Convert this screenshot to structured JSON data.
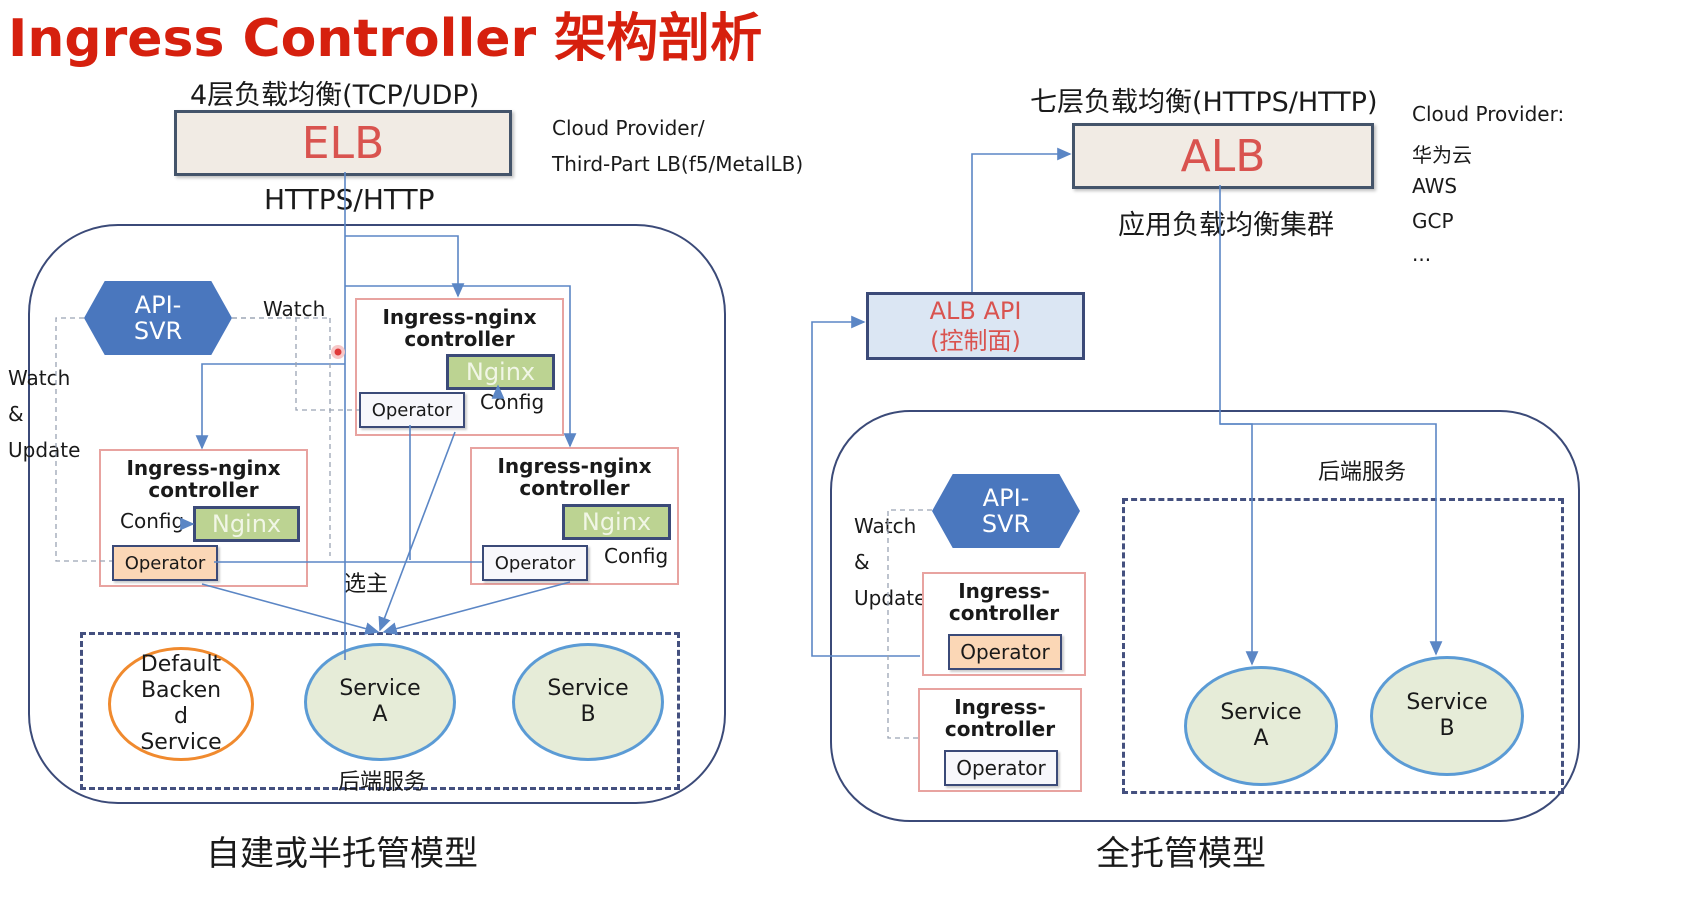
{
  "title": "Ingress Controller 架构剖析",
  "left": {
    "l4_label": "4层负载均衡(TCP/UDP)",
    "elb": "ELB",
    "cloud_line1": "Cloud Provider/",
    "cloud_line2": "Third-Part LB(f5/MetalLB)",
    "protocol": "HTTPS/HTTP",
    "apisvr_line1": "API-",
    "apisvr_line2": "SVR",
    "watch": "Watch",
    "side_watch": "Watch",
    "side_amp": "&",
    "side_update": "Update",
    "ctrl_top_title": "Ingress-nginx\ncontroller",
    "ctrl_top_nginx": "Nginx",
    "ctrl_top_operator": "Operator",
    "ctrl_top_config": "Config",
    "ctrl_left_title": "Ingress-nginx\ncontroller",
    "ctrl_left_nginx": "Nginx",
    "ctrl_left_config": "Config",
    "ctrl_left_operator": "Operator",
    "ctrl_right_title": "Ingress-nginx\ncontroller",
    "ctrl_right_nginx": "Nginx",
    "ctrl_right_operator": "Operator",
    "ctrl_right_config": "Config",
    "leader": "选主",
    "svc_default": "Default\nBacken\nd\nService",
    "svc_a": "Service\nA",
    "svc_b": "Service\nB",
    "backend": "后端服务",
    "caption": "自建或半托管模型"
  },
  "right": {
    "l7_label": "七层负载均衡(HTTPS/HTTP)",
    "alb": "ALB",
    "alb_cluster": "应用负载均衡集群",
    "cloud_label": "Cloud Provider:",
    "cloud_items": [
      "华为云",
      "AWS",
      "GCP",
      "..."
    ],
    "alb_api_line1": "ALB API",
    "alb_api_line2": "(控制面)",
    "backend": "后端服务",
    "apisvr_line1": "API-",
    "apisvr_line2": "SVR",
    "side_watch": "Watch",
    "side_amp": "&",
    "side_update": "Update",
    "ctrl1_title": "Ingress-\ncontroller",
    "ctrl1_operator": "Operator",
    "ctrl2_title": "Ingress-\ncontroller",
    "ctrl2_operator": "Operator",
    "svc_a": "Service\nA",
    "svc_b": "Service\nB",
    "caption": "全托管模型"
  },
  "colors": {
    "title": "#d6200e",
    "lb_text": "#d9534f",
    "hex": "#4a77be",
    "nginx": "#bcd392",
    "arrow": "#5b86c5"
  }
}
